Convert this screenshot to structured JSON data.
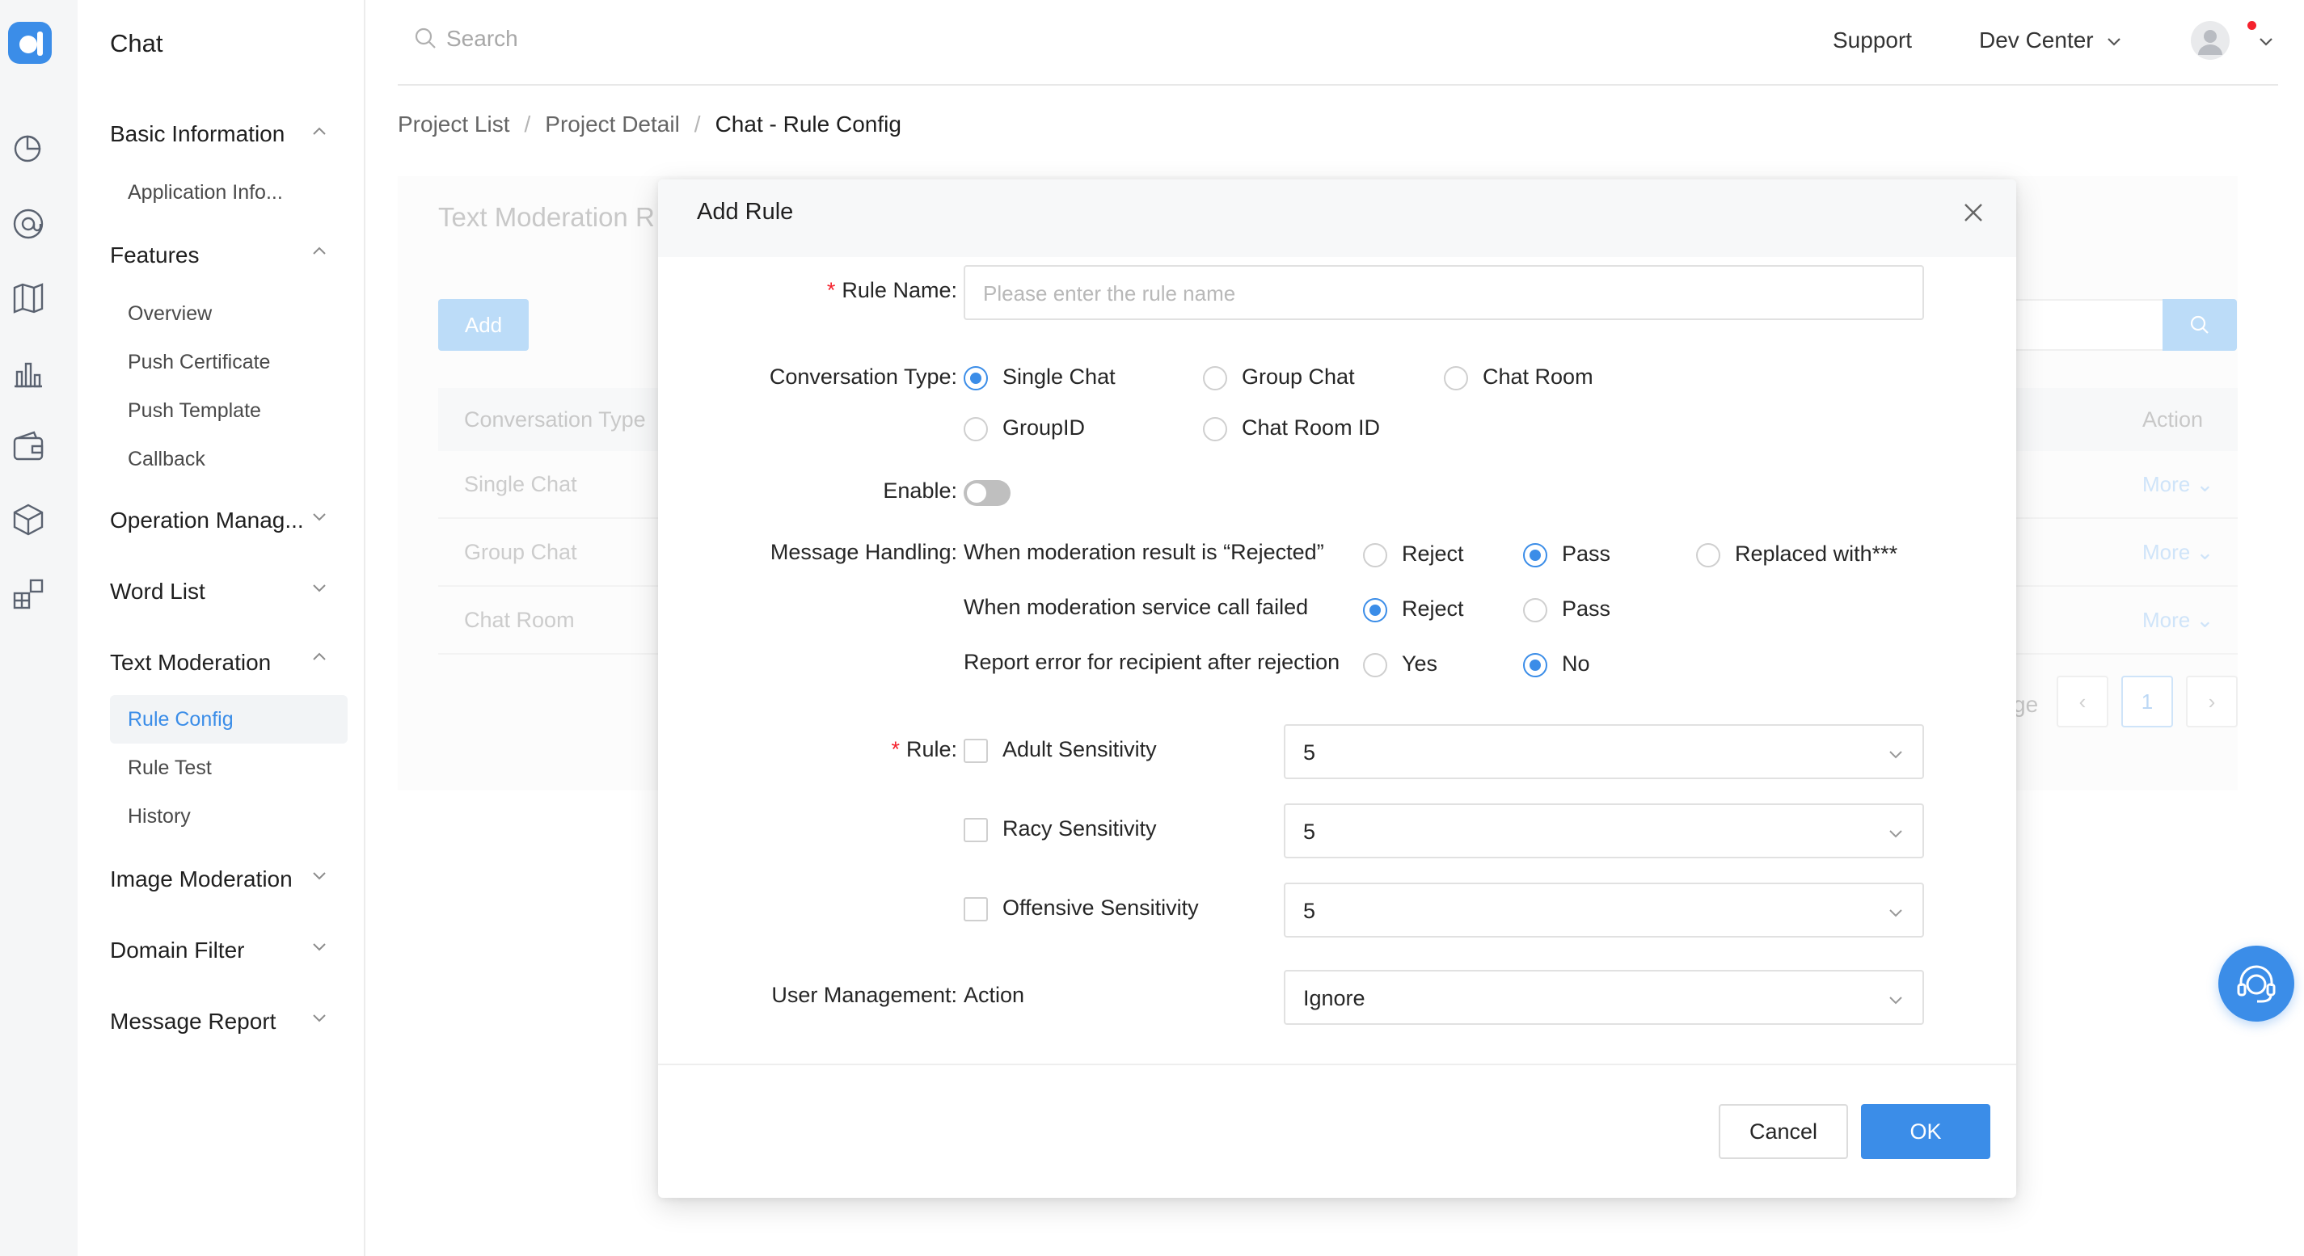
{
  "app": {
    "title": "Chat"
  },
  "sidebar": {
    "groups": [
      {
        "label": "Basic Information",
        "expanded": true,
        "items": [
          "Application Info..."
        ]
      },
      {
        "label": "Features",
        "expanded": true,
        "items": [
          "Overview",
          "Push Certificate",
          "Push Template",
          "Callback"
        ]
      },
      {
        "label": "Operation Manag...",
        "expanded": false,
        "items": []
      },
      {
        "label": "Word List",
        "expanded": false,
        "items": []
      },
      {
        "label": "Text Moderation",
        "expanded": true,
        "items": [
          "Rule Config",
          "Rule Test",
          "History"
        ],
        "active_item": "Rule Config"
      },
      {
        "label": "Image Moderation",
        "expanded": false,
        "items": []
      },
      {
        "label": "Domain Filter",
        "expanded": false,
        "items": []
      },
      {
        "label": "Message Report",
        "expanded": false,
        "items": []
      }
    ]
  },
  "header": {
    "search_placeholder": "Search",
    "support": "Support",
    "dev_center": "Dev Center"
  },
  "breadcrumb": {
    "items": [
      "Project List",
      "Project Detail",
      "Chat - Rule Config"
    ],
    "separator": "/"
  },
  "background_page": {
    "title": "Text Moderation R",
    "add_button": "Add",
    "columns": [
      "Conversation Type",
      "Action"
    ],
    "rows": [
      {
        "conversation_type": "Single Chat",
        "action": "More"
      },
      {
        "conversation_type": "Group Chat",
        "action": "More"
      },
      {
        "conversation_type": "Chat Room",
        "action": "More"
      }
    ],
    "pagination": {
      "prefix_text": "ge",
      "current_page": "1"
    }
  },
  "modal": {
    "title": "Add Rule",
    "rule_name": {
      "label": "Rule Name",
      "placeholder": "Please enter the rule name",
      "required": true
    },
    "conversation_type": {
      "label": "Conversation Type",
      "options": [
        "Single Chat",
        "Group Chat",
        "Chat Room",
        "GroupID",
        "Chat Room ID"
      ],
      "selected": "Single Chat"
    },
    "enable": {
      "label": "Enable",
      "value": false
    },
    "message_handling": {
      "label": "Message Handling",
      "rows": [
        {
          "label": "When moderation result is “Rejected”",
          "options": [
            "Reject",
            "Pass",
            "Replaced with***"
          ],
          "selected": "Pass"
        },
        {
          "label": "When moderation service call failed",
          "options": [
            "Reject",
            "Pass"
          ],
          "selected": "Reject"
        },
        {
          "label": "Report error for recipient after rejection",
          "options": [
            "Yes",
            "No"
          ],
          "selected": "No"
        }
      ]
    },
    "rule": {
      "label": "Rule",
      "required": true,
      "items": [
        {
          "label": "Adult Sensitivity",
          "checked": false,
          "value": "5"
        },
        {
          "label": "Racy Sensitivity",
          "checked": false,
          "value": "5"
        },
        {
          "label": "Offensive Sensitivity",
          "checked": false,
          "value": "5"
        }
      ]
    },
    "user_management": {
      "label": "User Management",
      "action_label": "Action",
      "value": "Ignore"
    },
    "cancel": "Cancel",
    "ok": "OK"
  },
  "colors": {
    "accent": "#3b8de8",
    "required": "#f5222d",
    "notification": "#f5222d"
  }
}
